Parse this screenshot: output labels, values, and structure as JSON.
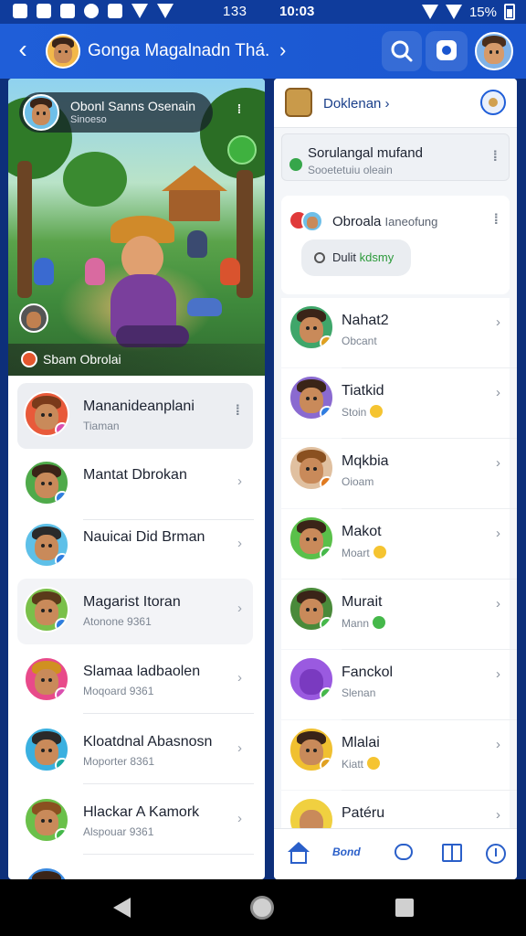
{
  "status_bar": {
    "time_left": "133",
    "time_center": "10:03",
    "battery": "15%"
  },
  "app_bar": {
    "title": "Gonga Magalnadn Thá.",
    "back_label": "‹",
    "chevron": "›"
  },
  "left_panel": {
    "chip_title": "Obonl Sanns Osenain",
    "chip_subtitle": "Sinoeso",
    "banner_text": "Sbam Obrolai",
    "contacts": [
      {
        "name": "Mananideanplani",
        "sub": "Tiaman",
        "dot": "#d94fb0"
      },
      {
        "name": "Mantat Dbrokan",
        "sub": "",
        "dot": "#2f7de0"
      },
      {
        "name": "Nauicai Did Brman",
        "sub": "",
        "dot": "#2f7de0"
      },
      {
        "name": "Magarist Itoran",
        "sub": "Atonone 9361",
        "dot": "#2f7de0"
      },
      {
        "name": "Slamaa ladbaolen",
        "sub": "Moqoard 9361",
        "dot": "#d94fb0"
      },
      {
        "name": "Kloatdnal Abasnosn",
        "sub": "Moporter 8361",
        "dot": "#1aa8a0"
      },
      {
        "name": "Hlackar A Kamork",
        "sub": "Alspouar 9361",
        "dot": "#45b84a"
      }
    ]
  },
  "right_panel": {
    "header_label": "Doklenan",
    "card_title": "Sorulangal mufand",
    "card_subtitle": "Sooetetuiu oleain",
    "chat_title": "Obroala",
    "chat_tag": "Ianeofung",
    "bubble_text": "Dulit",
    "bubble_highlight": "kdsmy",
    "contacts": [
      {
        "name": "Nahat2",
        "sub": "Obcant",
        "emoji": "",
        "dot": "#e0a020"
      },
      {
        "name": "Tiatkid",
        "sub": "Stoin",
        "emoji": "yellow",
        "dot": "#2f7de0"
      },
      {
        "name": "Mqkbia",
        "sub": "Oioam",
        "emoji": "",
        "dot": "#e07a20"
      },
      {
        "name": "Makot",
        "sub": "Moart",
        "emoji": "yellow",
        "dot": "#45b84a"
      },
      {
        "name": "Murait",
        "sub": "Mann",
        "emoji": "green",
        "dot": "#45b84a"
      },
      {
        "name": "Fanckol",
        "sub": "Slenan",
        "emoji": "",
        "dot": "#45b84a"
      },
      {
        "name": "Mlalai",
        "sub": "Kiatt",
        "emoji": "yellow",
        "dot": "#e0a020"
      },
      {
        "name": "Patéru",
        "sub": "",
        "emoji": "",
        "dot": "#e0a020"
      }
    ],
    "nav_text": "Bond"
  },
  "colors": {
    "brand": "#1f5ed8",
    "status_bar": "#0f3c9c",
    "nav_icon": "#2a5fc9"
  }
}
